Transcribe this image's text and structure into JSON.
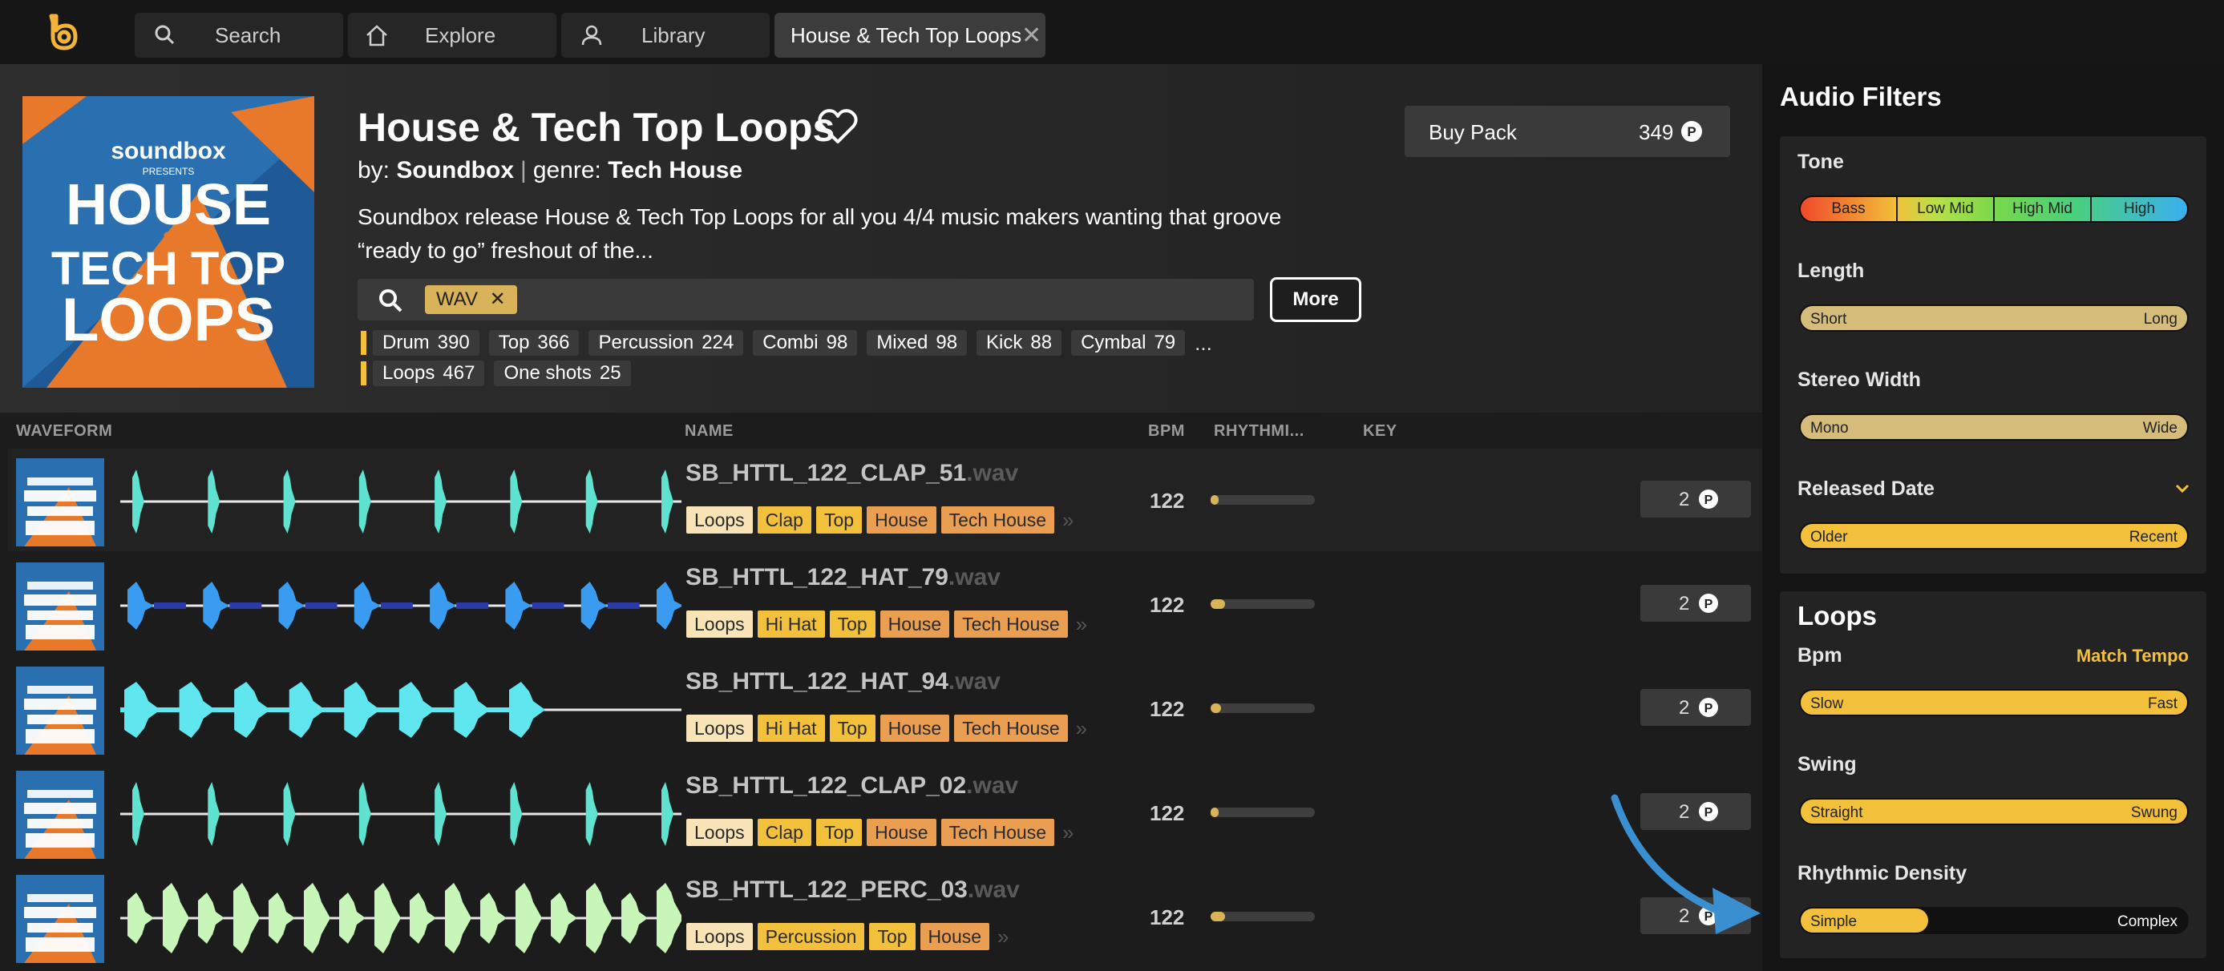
{
  "nav": {
    "tabs": [
      {
        "label": "Search",
        "icon": "search-icon"
      },
      {
        "label": "Explore",
        "icon": "home-icon"
      },
      {
        "label": "Library",
        "icon": "user-icon"
      },
      {
        "label": "House & Tech Top Loops",
        "icon": "close-icon"
      }
    ],
    "close_glyph": "✕"
  },
  "pack": {
    "title": "House & Tech Top Loops",
    "by_label": "by:",
    "author": "Soundbox",
    "genre_label": "genre:",
    "genre": "Tech House",
    "description": "Soundbox release House & Tech Top Loops for all you 4/4 music makers wanting that groove “ready to go” freshout of the...",
    "buy_label": "Buy Pack",
    "price": "349",
    "price_icon": "P",
    "more_label": "More",
    "cover": {
      "brand": "soundbox",
      "presents": "PRESENTS",
      "line1": "HOUSE",
      "amp": "&",
      "line2": "TECH TOP",
      "line3": "LOOPS"
    }
  },
  "search": {
    "chip": "WAV",
    "chip_close": "✕"
  },
  "filters": {
    "row1": [
      {
        "label": "Drum",
        "count": "390"
      },
      {
        "label": "Top",
        "count": "366"
      },
      {
        "label": "Percussion",
        "count": "224"
      },
      {
        "label": "Combi",
        "count": "98"
      },
      {
        "label": "Mixed",
        "count": "98"
      },
      {
        "label": "Kick",
        "count": "88"
      },
      {
        "label": "Cymbal",
        "count": "79"
      }
    ],
    "ellipsis": "...",
    "row2": [
      {
        "label": "Loops",
        "count": "467"
      },
      {
        "label": "One shots",
        "count": "25"
      }
    ]
  },
  "table": {
    "headers": {
      "waveform": "WAVEFORM",
      "name": "NAME",
      "bpm": "BPM",
      "rhythm": "RHYTHMI...",
      "key": "KEY"
    },
    "rows": [
      {
        "name": "SB_HTTL_122_CLAP_51",
        "ext": ".wav",
        "tags": [
          "Loops",
          "Clap",
          "Top",
          "House",
          "Tech House"
        ],
        "bpm": "122",
        "rhythm": 0.08,
        "price": "2",
        "wave_color": "#5fe3d0",
        "wave_type": "clap"
      },
      {
        "name": "SB_HTTL_122_HAT_79",
        "ext": ".wav",
        "tags": [
          "Loops",
          "Hi Hat",
          "Top",
          "House",
          "Tech House"
        ],
        "bpm": "122",
        "rhythm": 0.14,
        "price": "2",
        "wave_color": "#3a9cf0",
        "wave_type": "hat"
      },
      {
        "name": "SB_HTTL_122_HAT_94",
        "ext": ".wav",
        "tags": [
          "Loops",
          "Hi Hat",
          "Top",
          "House",
          "Tech House"
        ],
        "bpm": "122",
        "rhythm": 0.1,
        "price": "2",
        "wave_color": "#5fe6ef",
        "wave_type": "hat2"
      },
      {
        "name": "SB_HTTL_122_CLAP_02",
        "ext": ".wav",
        "tags": [
          "Loops",
          "Clap",
          "Top",
          "House",
          "Tech House"
        ],
        "bpm": "122",
        "rhythm": 0.08,
        "price": "2",
        "wave_color": "#5fe3d0",
        "wave_type": "clap"
      },
      {
        "name": "SB_HTTL_122_PERC_03",
        "ext": ".wav",
        "tags": [
          "Loops",
          "Percussion",
          "Top",
          "House"
        ],
        "bpm": "122",
        "rhythm": 0.14,
        "price": "2",
        "wave_color": "#c8f5b8",
        "wave_type": "perc"
      }
    ],
    "more_tags_glyph": "»"
  },
  "sidebar": {
    "title": "Audio Filters",
    "tone": {
      "label": "Tone",
      "bands": [
        "Bass",
        "Low Mid",
        "High Mid",
        "High"
      ]
    },
    "length": {
      "label": "Length",
      "min": "Short",
      "max": "Long"
    },
    "stereo": {
      "label": "Stereo Width",
      "min": "Mono",
      "max": "Wide"
    },
    "released": {
      "label": "Released Date",
      "min": "Older",
      "max": "Recent"
    },
    "loops": {
      "title": "Loops",
      "bpm": {
        "label": "Bpm",
        "action": "Match Tempo",
        "min": "Slow",
        "max": "Fast"
      },
      "swing": {
        "label": "Swing",
        "min": "Straight",
        "max": "Swung"
      },
      "density": {
        "label": "Rhythmic Density",
        "min": "Simple",
        "max": "Complex",
        "level": 0.33
      }
    }
  },
  "colors": {
    "accent": "#f2c03a",
    "tan": "#d6bc7a",
    "orange": "#ea9e52",
    "annotation_arrow": "#3a8fd0"
  }
}
